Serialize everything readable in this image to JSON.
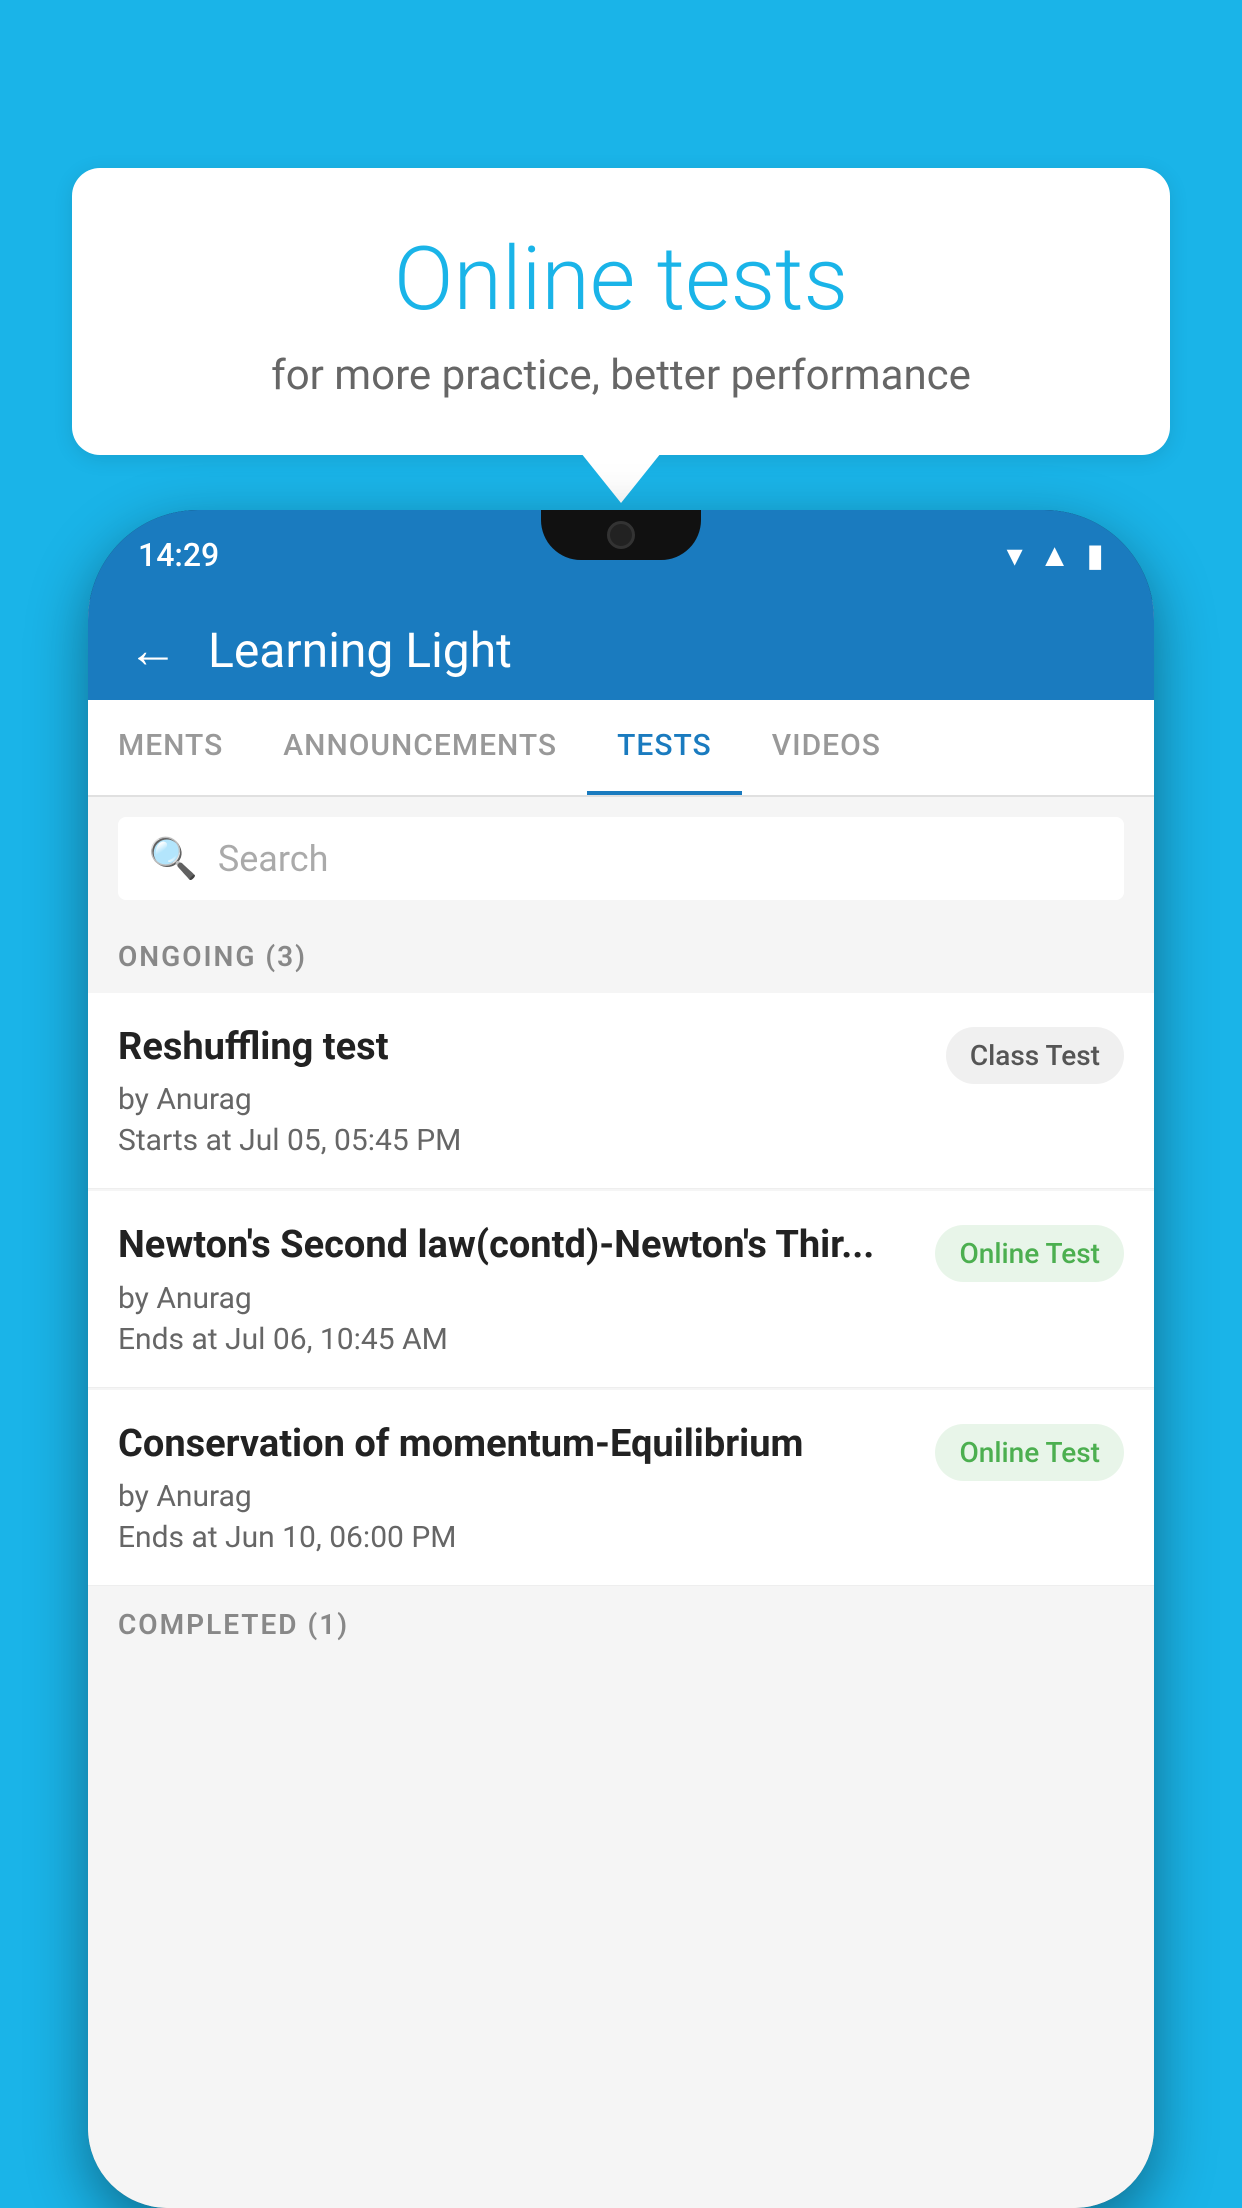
{
  "background": {
    "color": "#1ab4e8"
  },
  "speech_bubble": {
    "title": "Online tests",
    "subtitle": "for more practice, better performance"
  },
  "status_bar": {
    "time": "14:29",
    "icons": [
      "wifi",
      "signal",
      "battery"
    ]
  },
  "app_header": {
    "title": "Learning Light",
    "back_label": "←"
  },
  "tabs": [
    {
      "label": "MENTS",
      "active": false
    },
    {
      "label": "ANNOUNCEMENTS",
      "active": false
    },
    {
      "label": "TESTS",
      "active": true
    },
    {
      "label": "VIDEOS",
      "active": false
    }
  ],
  "search": {
    "placeholder": "Search"
  },
  "sections": [
    {
      "header": "ONGOING (3)",
      "items": [
        {
          "title": "Reshuffling test",
          "author": "by Anurag",
          "date": "Starts at  Jul 05, 05:45 PM",
          "badge": "Class Test",
          "badge_type": "class"
        },
        {
          "title": "Newton's Second law(contd)-Newton's Thir...",
          "author": "by Anurag",
          "date": "Ends at  Jul 06, 10:45 AM",
          "badge": "Online Test",
          "badge_type": "online"
        },
        {
          "title": "Conservation of momentum-Equilibrium",
          "author": "by Anurag",
          "date": "Ends at  Jun 10, 06:00 PM",
          "badge": "Online Test",
          "badge_type": "online"
        }
      ]
    }
  ],
  "completed_section": {
    "header": "COMPLETED (1)"
  }
}
